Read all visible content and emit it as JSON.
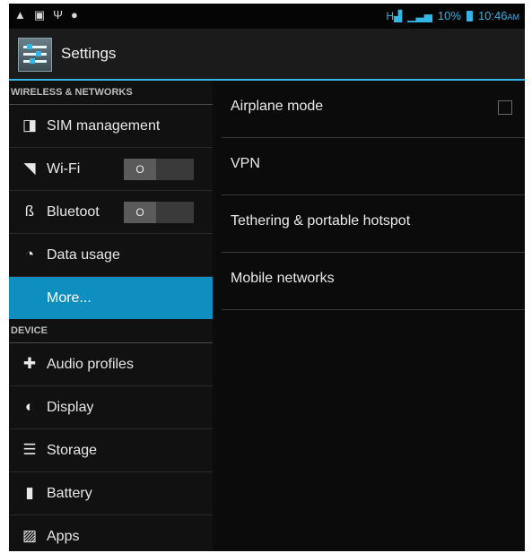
{
  "statusbar": {
    "left_icons": [
      "warning-icon",
      "image-icon",
      "usb-icon",
      "android-icon"
    ],
    "network_type": "H",
    "battery_percent": "10%",
    "time": "10:46",
    "time_suffix": "AM"
  },
  "actionbar": {
    "title": "Settings"
  },
  "sidebar": {
    "sections": [
      {
        "header": "WIRELESS & NETWORKS",
        "items": [
          {
            "label": "SIM management",
            "icon": "sim-icon"
          },
          {
            "label": "Wi-Fi",
            "icon": "wifi-icon",
            "toggle": "O"
          },
          {
            "label": "Bluetoot",
            "icon": "bluetooth-icon",
            "toggle": "O"
          },
          {
            "label": "Data usage",
            "icon": "data-usage-icon"
          },
          {
            "label": "More...",
            "selected": true
          }
        ]
      },
      {
        "header": "DEVICE",
        "items": [
          {
            "label": "Audio profiles",
            "icon": "audio-profiles-icon"
          },
          {
            "label": "Display",
            "icon": "display-icon"
          },
          {
            "label": "Storage",
            "icon": "storage-icon"
          },
          {
            "label": "Battery",
            "icon": "battery-icon"
          },
          {
            "label": "Apps",
            "icon": "apps-icon"
          }
        ]
      }
    ]
  },
  "main": {
    "items": [
      {
        "label": "Airplane mode",
        "checkbox": false
      },
      {
        "label": "VPN"
      },
      {
        "label": "Tethering & portable hotspot"
      },
      {
        "label": "Mobile networks"
      }
    ]
  },
  "colors": {
    "accent": "#33b5e5",
    "selected": "#0f8fc0",
    "background": "#0d0d0d"
  }
}
